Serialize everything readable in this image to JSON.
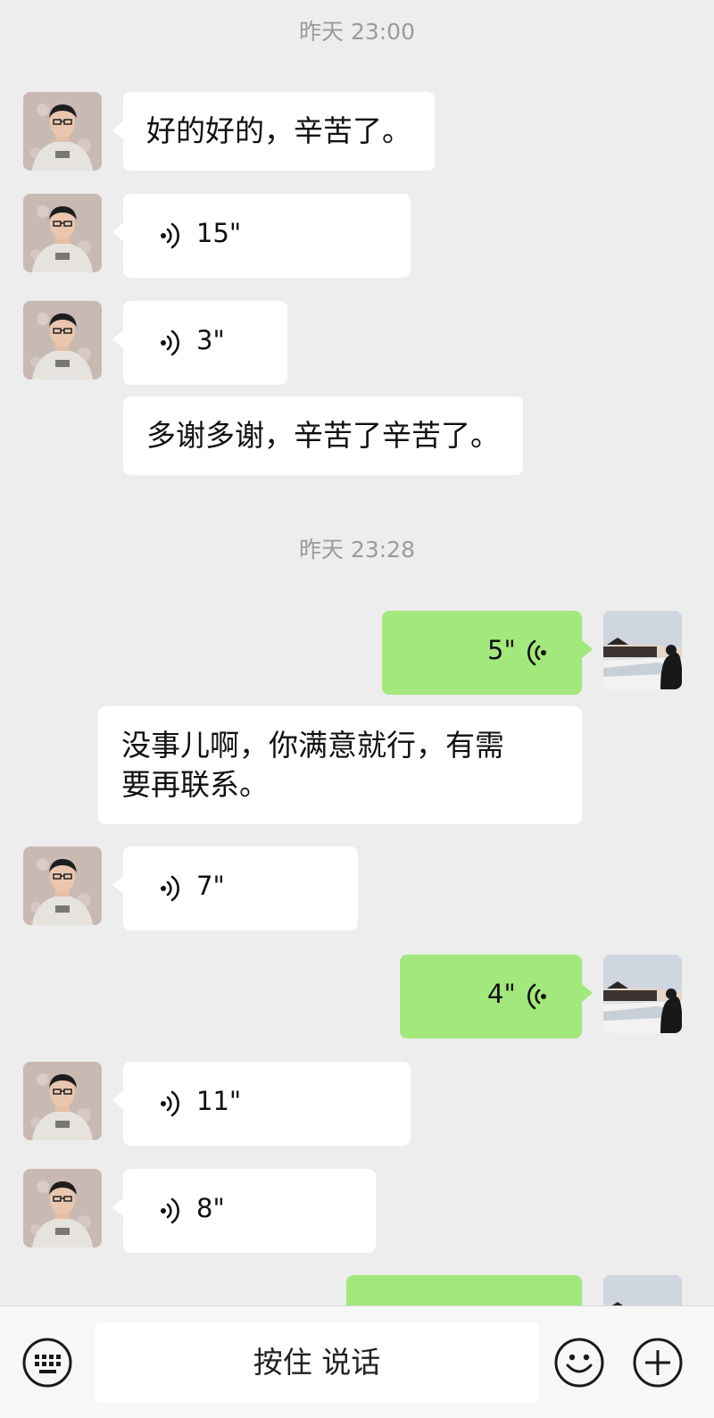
{
  "chat": {
    "timestamps": [
      "昨天 23:00",
      "昨天 23:28"
    ],
    "messages": [
      {
        "type": "text",
        "text": "好的好的，辛苦了。"
      },
      {
        "type": "voice",
        "duration": "15\""
      },
      {
        "type": "voice",
        "duration": "3\""
      },
      {
        "type": "text",
        "text": "多谢多谢，辛苦了辛苦了。"
      },
      {
        "type": "voice",
        "duration": "5\""
      },
      {
        "type": "text",
        "line1": "没事儿啊，你满意就行，有需",
        "line2": "要再联系。"
      },
      {
        "type": "voice",
        "duration": "7\""
      },
      {
        "type": "voice",
        "duration": "4\""
      },
      {
        "type": "voice",
        "duration": "11\""
      },
      {
        "type": "voice",
        "duration": "8\""
      }
    ]
  },
  "input_bar": {
    "hold_to_talk_label": "按住 说话",
    "keyboard_icon": "keyboard-icon",
    "emoji_icon": "emoji-icon",
    "plus_icon": "plus-icon"
  },
  "colors": {
    "background": "#ededed",
    "outgoing_bubble": "#a3e87c",
    "incoming_bubble": "#ffffff"
  }
}
